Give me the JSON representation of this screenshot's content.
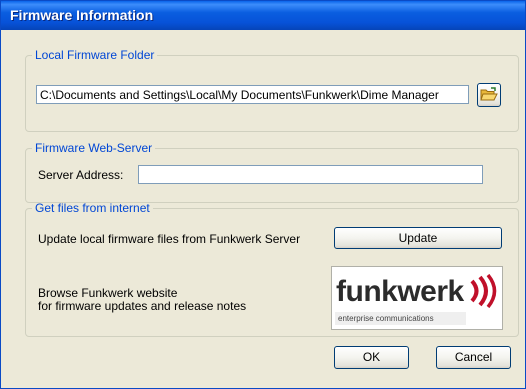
{
  "window": {
    "title": "Firmware Information"
  },
  "local_folder": {
    "legend": "Local Firmware Folder",
    "path": "C:\\Documents and Settings\\Local\\My Documents\\Funkwerk\\Dime Manager",
    "browse_icon": "folder-open-icon"
  },
  "web_server": {
    "legend": "Firmware Web-Server",
    "address_label": "Server Address:",
    "address_value": ""
  },
  "internet": {
    "legend": "Get files from internet",
    "update_text": "Update local firmware files from Funkwerk Server",
    "update_button": "Update",
    "browse_text_line1": "Browse Funkwerk website",
    "browse_text_line2": "for firmware updates and release notes",
    "logo": {
      "wordmark": "funkwerk",
      "tagline": "enterprise communications",
      "accent_color": "#c0102a"
    }
  },
  "buttons": {
    "ok": "OK",
    "cancel": "Cancel"
  },
  "colors": {
    "title_bar": "#0a5ee0",
    "group_legend": "#0046d5",
    "window_bg": "#ece9d8"
  }
}
